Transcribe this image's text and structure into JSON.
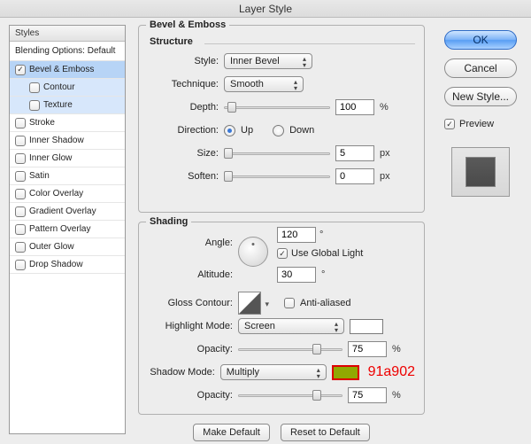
{
  "window": {
    "title": "Layer Style"
  },
  "sidebar": {
    "header": "Styles",
    "blending": "Blending Options: Default",
    "items": [
      {
        "label": "Bevel & Emboss",
        "checked": true,
        "selected": true
      },
      {
        "label": "Contour",
        "checked": false,
        "sub": true,
        "selected": true
      },
      {
        "label": "Texture",
        "checked": false,
        "sub": true,
        "selected": true
      },
      {
        "label": "Stroke",
        "checked": false
      },
      {
        "label": "Inner Shadow",
        "checked": false
      },
      {
        "label": "Inner Glow",
        "checked": false
      },
      {
        "label": "Satin",
        "checked": false
      },
      {
        "label": "Color Overlay",
        "checked": false
      },
      {
        "label": "Gradient Overlay",
        "checked": false
      },
      {
        "label": "Pattern Overlay",
        "checked": false
      },
      {
        "label": "Outer Glow",
        "checked": false
      },
      {
        "label": "Drop Shadow",
        "checked": false
      }
    ]
  },
  "buttons": {
    "ok": "OK",
    "cancel": "Cancel",
    "newstyle": "New Style...",
    "preview": "Preview",
    "make_default": "Make Default",
    "reset_default": "Reset to Default"
  },
  "panel": {
    "title": "Bevel & Emboss",
    "structure": {
      "heading": "Structure",
      "style_label": "Style:",
      "style_value": "Inner Bevel",
      "technique_label": "Technique:",
      "technique_value": "Smooth",
      "depth_label": "Depth:",
      "depth_value": "100",
      "depth_unit": "%",
      "direction_label": "Direction:",
      "direction_up": "Up",
      "direction_down": "Down",
      "size_label": "Size:",
      "size_value": "5",
      "size_unit": "px",
      "soften_label": "Soften:",
      "soften_value": "0",
      "soften_unit": "px"
    },
    "shading": {
      "heading": "Shading",
      "angle_label": "Angle:",
      "angle_value": "120",
      "angle_unit": "°",
      "global_light": "Use Global Light",
      "altitude_label": "Altitude:",
      "altitude_value": "30",
      "altitude_unit": "°",
      "gloss_label": "Gloss Contour:",
      "antialiased": "Anti-aliased",
      "highlight_mode_label": "Highlight Mode:",
      "highlight_mode_value": "Screen",
      "highlight_opacity_label": "Opacity:",
      "highlight_opacity_value": "75",
      "highlight_opacity_unit": "%",
      "shadow_mode_label": "Shadow Mode:",
      "shadow_mode_value": "Multiply",
      "shadow_color": "#91a902",
      "shadow_color_text": "91a902",
      "shadow_opacity_label": "Opacity:",
      "shadow_opacity_value": "75",
      "shadow_opacity_unit": "%"
    }
  }
}
